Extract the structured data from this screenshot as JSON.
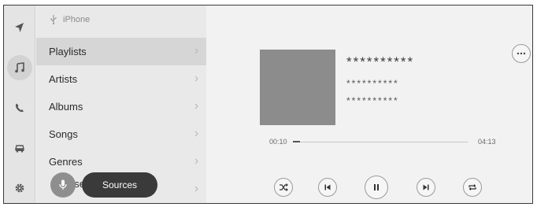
{
  "rail": {
    "items": [
      {
        "icon": "navigation-arrow-icon"
      },
      {
        "icon": "music-note-icon",
        "active": true
      },
      {
        "icon": "phone-icon"
      },
      {
        "icon": "car-icon"
      },
      {
        "icon": "gear-icon"
      }
    ]
  },
  "list": {
    "source_label": "iPhone",
    "items": [
      {
        "label": "Playlists"
      },
      {
        "label": "Artists"
      },
      {
        "label": "Albums"
      },
      {
        "label": "Songs"
      },
      {
        "label": "Genres"
      }
    ],
    "partial_label": "ose"
  },
  "overlay": {
    "sources_label": "Sources"
  },
  "now_playing": {
    "title": "**********",
    "artist": "**********",
    "album": "**********",
    "elapsed": "00:10",
    "duration": "04:13",
    "progress": 0.04
  },
  "controls": [
    "shuffle-icon",
    "previous-icon",
    "pause-icon",
    "next-icon",
    "repeat-icon"
  ]
}
